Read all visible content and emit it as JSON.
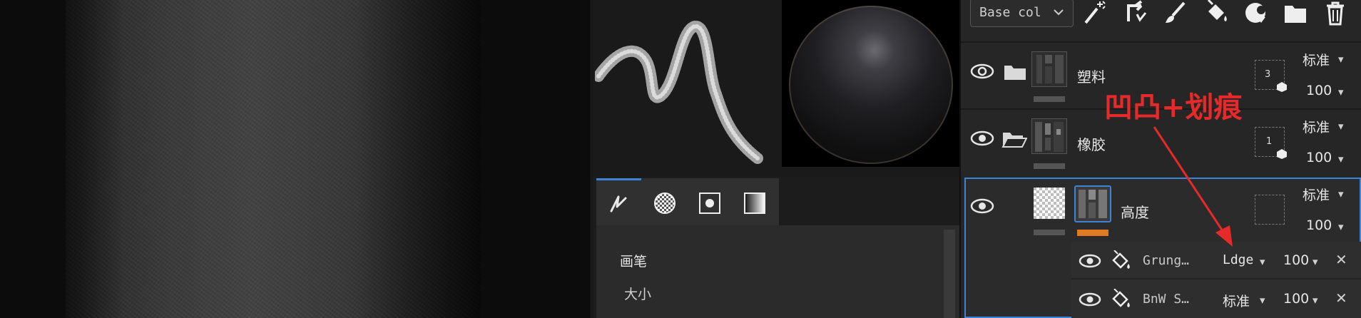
{
  "channel_select": {
    "value": "Base col"
  },
  "brush_section": {
    "title": "画笔",
    "size_label": "大小"
  },
  "layers": [
    {
      "name": "塑料",
      "type": "folder-closed",
      "blend": "标准",
      "opacity": "100",
      "mask_count": "3"
    },
    {
      "name": "橡胶",
      "type": "folder-open",
      "blend": "标准",
      "opacity": "100",
      "mask_count": "1"
    },
    {
      "name": "高度",
      "type": "fill",
      "blend": "标准",
      "opacity": "100",
      "effects": [
        {
          "name": "Grung…",
          "blend": "Ldge",
          "opacity": "100"
        },
        {
          "name": "BnW S…",
          "blend": "标准",
          "opacity": "100"
        }
      ]
    }
  ],
  "annotation": {
    "text": "凹凸+划痕",
    "color": "#e62a2a"
  },
  "colors": {
    "accent": "#3d84d9",
    "layer_tag": "#e07a20",
    "annotation": "#e62a2a"
  }
}
